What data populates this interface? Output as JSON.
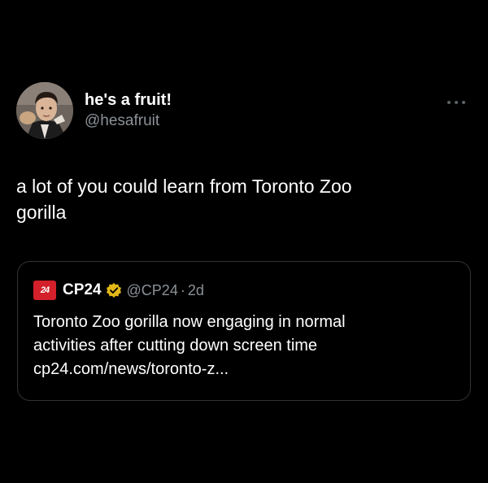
{
  "tweet": {
    "author": {
      "display_name": "he's a fruit!",
      "handle": "@hesafruit",
      "avatar_icon": "person-avatar"
    },
    "more_icon": "more-options-icon",
    "text_lines": [
      "a lot of you could learn from Toronto Zoo",
      "gorilla"
    ]
  },
  "quoted_tweet": {
    "logo_text": "24",
    "logo_color": "#d3202a",
    "display_name": "CP24",
    "verified_icon": "gold-verified-badge-icon",
    "verified_color": "#e2b719",
    "handle": "@CP24",
    "separator": "·",
    "time": "2d",
    "text_lines": [
      "Toronto Zoo gorilla now engaging in normal",
      "activities after cutting down screen time",
      "cp24.com/news/toronto-z..."
    ]
  },
  "colors": {
    "background": "#000000",
    "primary_text": "#ffffff",
    "secondary_text": "#8b9197",
    "border": "#2f3336"
  }
}
